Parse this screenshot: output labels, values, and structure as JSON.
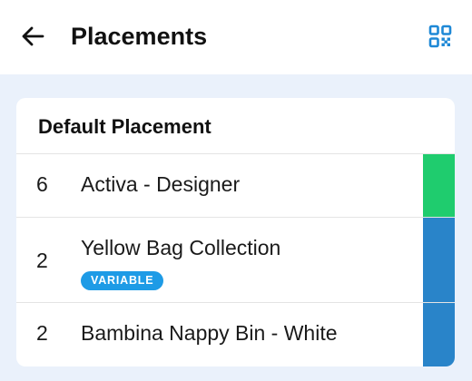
{
  "header": {
    "title": "Placements",
    "back_icon": "arrow-left-icon",
    "action_icon": "qr-code-icon",
    "accent": "#1e88d6"
  },
  "placement": {
    "title": "Default Placement",
    "items": [
      {
        "qty": "6",
        "name": "Activa - Designer",
        "badge": "",
        "status_color": "#1fcc6e"
      },
      {
        "qty": "2",
        "name": "Yellow Bag Collection",
        "badge": "VARIABLE",
        "status_color": "#2984c9"
      },
      {
        "qty": "2",
        "name": "Bambina Nappy Bin - White",
        "badge": "",
        "status_color": "#2984c9"
      }
    ]
  }
}
